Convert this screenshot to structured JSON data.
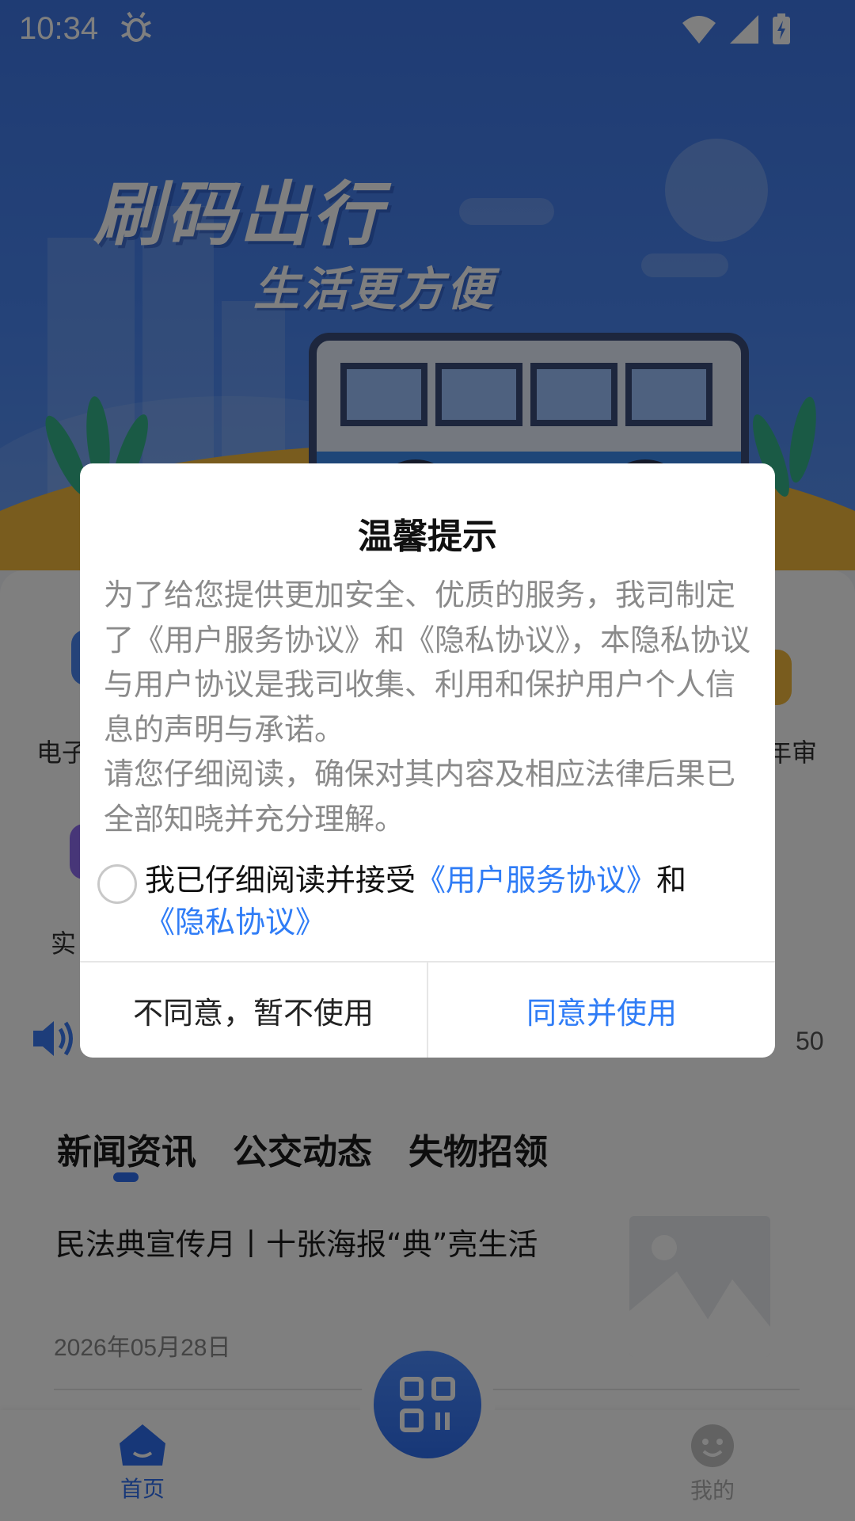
{
  "status_bar": {
    "time": "10:34",
    "bug_icon": "bug-icon"
  },
  "banner": {
    "title": "刷码出行",
    "subtitle": "生活更方便"
  },
  "grid": {
    "left_label": "电子",
    "right_label": "年审",
    "bottom_left_label": "实"
  },
  "notice": {
    "tail_text": "50"
  },
  "tabs": [
    "新闻资讯",
    "公交动态",
    "失物招领"
  ],
  "news": {
    "title": "民法典宣传月丨十张海报“典”亮生活",
    "date": "2026年05月28日"
  },
  "bottom_nav": {
    "home_label": "首页",
    "mine_label": "我的"
  },
  "dialog": {
    "title": "温馨提示",
    "paragraph1": "为了给您提供更加安全、优质的服务，我司制定了《用户服务协议》和《隐私协议》，本隐私协议与用户协议是我司收集、利用和保护用户个人信息的声明与承诺。",
    "paragraph2": "请您仔细阅读，确保对其内容及相应法律后果已全部知晓并充分理解。",
    "agree_prefix": "我已仔细阅读并接受",
    "agree_link1": "《用户服务协议》",
    "agree_and": "和",
    "agree_link2": "《隐私协议》",
    "disagree_button": "不同意，暂不使用",
    "agree_button": "同意并使用"
  },
  "colors": {
    "accent": "#2f7cf6",
    "banner": "#3f78e8",
    "hill": "#f3b93c"
  }
}
